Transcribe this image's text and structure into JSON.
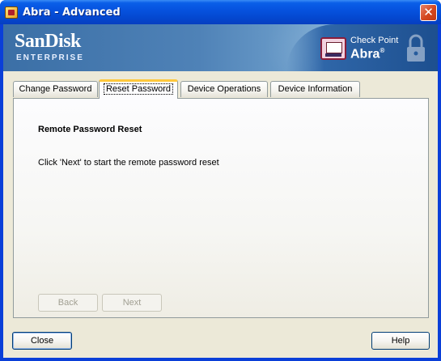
{
  "window": {
    "title": "Abra - Advanced",
    "close_glyph": "✕"
  },
  "banner": {
    "brand": "SanDisk",
    "brand_sub": "ENTERPRISE",
    "product_line1": "Check Point",
    "product_line2": "Abra",
    "product_mark": "®"
  },
  "tabs": [
    {
      "label": "Change Password",
      "active": false
    },
    {
      "label": "Reset Password",
      "active": true
    },
    {
      "label": "Device Operations",
      "active": false
    },
    {
      "label": "Device Information",
      "active": false
    }
  ],
  "panel": {
    "heading": "Remote Password Reset",
    "text": "Click 'Next' to start the remote password reset"
  },
  "wizard_buttons": {
    "back_label": "Back",
    "next_label": "Next",
    "back_enabled": false,
    "next_enabled": false
  },
  "footer": {
    "close_label": "Close",
    "help_label": "Help"
  },
  "icons": {
    "title_icon": "abra-app-icon",
    "banner_icon": "check-point-abra-icon",
    "banner_watermark": "padlock-icon"
  }
}
